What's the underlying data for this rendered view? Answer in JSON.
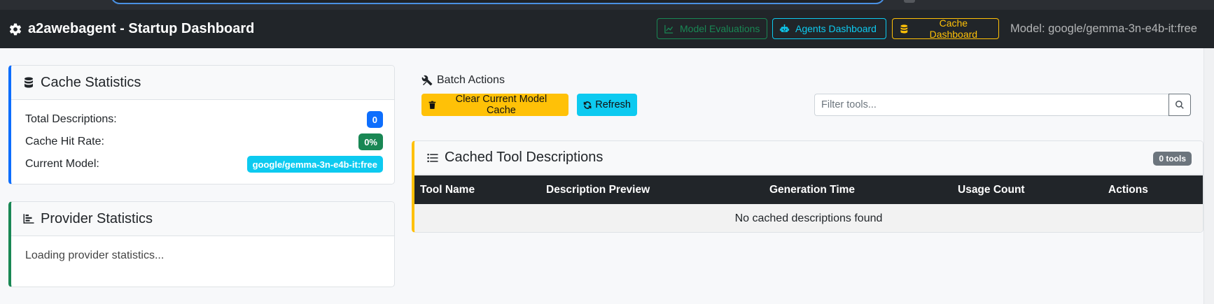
{
  "navbar": {
    "brand_title": "a2awebagent - Startup Dashboard",
    "buttons": {
      "model_evaluations": "Model Evaluations",
      "agents_dashboard": "Agents Dashboard",
      "cache_dashboard": "Cache Dashboard"
    },
    "model_label": "Model: google/gemma-3n-e4b-it:free"
  },
  "cache_statistics": {
    "title": "Cache Statistics",
    "rows": [
      {
        "label": "Total Descriptions:",
        "value": "0"
      },
      {
        "label": "Cache Hit Rate:",
        "value": "0%"
      },
      {
        "label": "Current Model:",
        "value": "google/gemma-3n-e4b-it:free"
      }
    ]
  },
  "provider_statistics": {
    "title": "Provider Statistics",
    "loading_text": "Loading provider statistics..."
  },
  "batch_actions": {
    "title": "Batch Actions",
    "clear_label": "Clear Current Model Cache",
    "refresh_label": "Refresh"
  },
  "filter": {
    "placeholder": "Filter tools...",
    "value": ""
  },
  "cached_tools": {
    "title": "Cached Tool Descriptions",
    "count_badge": "0 tools",
    "columns": [
      "Tool Name",
      "Description Preview",
      "Generation Time",
      "Usage Count",
      "Actions"
    ],
    "empty_message": "No cached descriptions found"
  },
  "colors": {
    "primary": "#0d6efd",
    "success": "#198754",
    "info": "#0dcaf0",
    "warning": "#ffc107",
    "dark": "#212529",
    "secondary": "#6c757d"
  },
  "icons": {
    "brand": "gear-icon",
    "model_evaluations": "line-chart-icon",
    "agents_dashboard": "robot-icon",
    "cache_dashboard": "database-icon",
    "cache_statistics": "database-icon",
    "provider_statistics": "bar-chart-icon",
    "batch_actions": "tools-icon",
    "clear": "trash-icon",
    "refresh": "refresh-icon",
    "search": "search-icon",
    "cached_tools": "list-icon"
  }
}
